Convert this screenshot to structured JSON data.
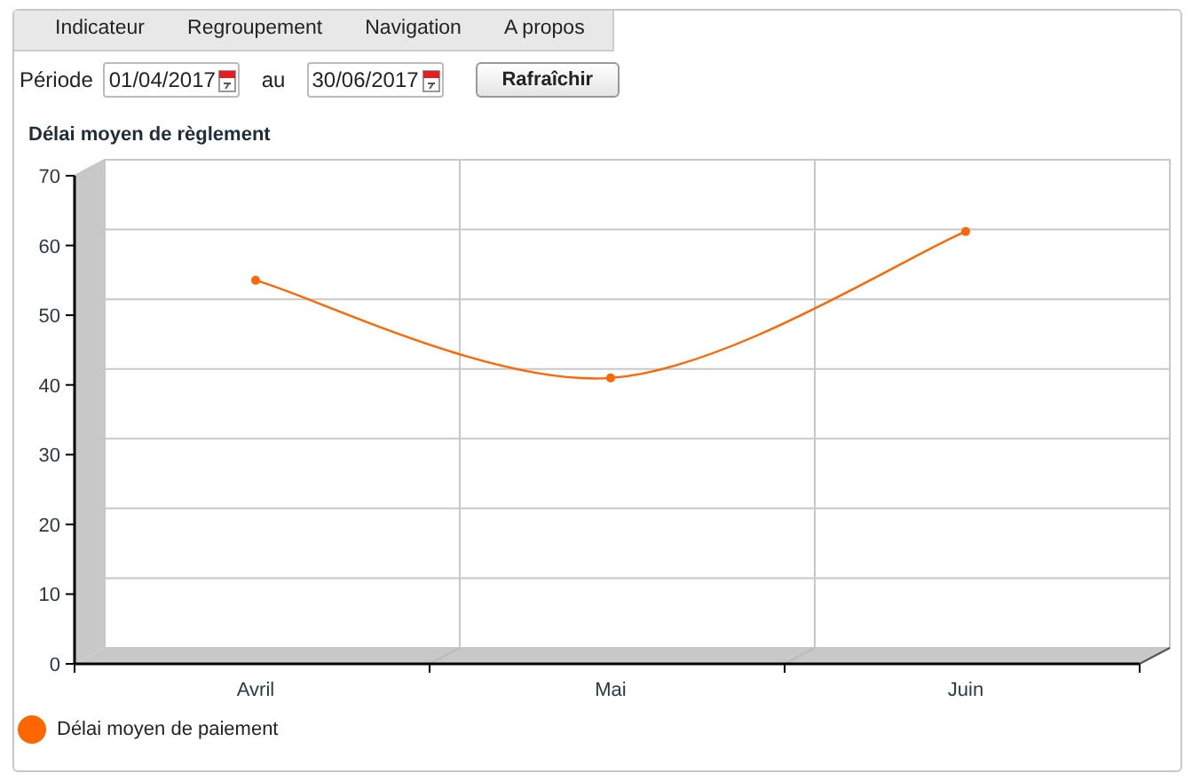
{
  "menu": [
    {
      "label": "Indicateur"
    },
    {
      "label": "Regroupement"
    },
    {
      "label": "Navigation"
    },
    {
      "label": "A propos"
    }
  ],
  "filter": {
    "period_label": "Période",
    "from": "01/04/2017",
    "to_label": "au",
    "to": "30/06/2017",
    "refresh_button": "Rafraîchir"
  },
  "chart_title": "Délai moyen de règlement",
  "chart_data": {
    "type": "line",
    "categories": [
      "Avril",
      "Mai",
      "Juin"
    ],
    "series": [
      {
        "name": "Délai moyen de paiement",
        "color": "#ff6600",
        "marker": "circle",
        "values": [
          55,
          41,
          62
        ]
      }
    ],
    "ylim": [
      0,
      70
    ],
    "yticks": [
      0,
      10,
      20,
      30,
      40,
      50,
      60,
      70
    ]
  }
}
